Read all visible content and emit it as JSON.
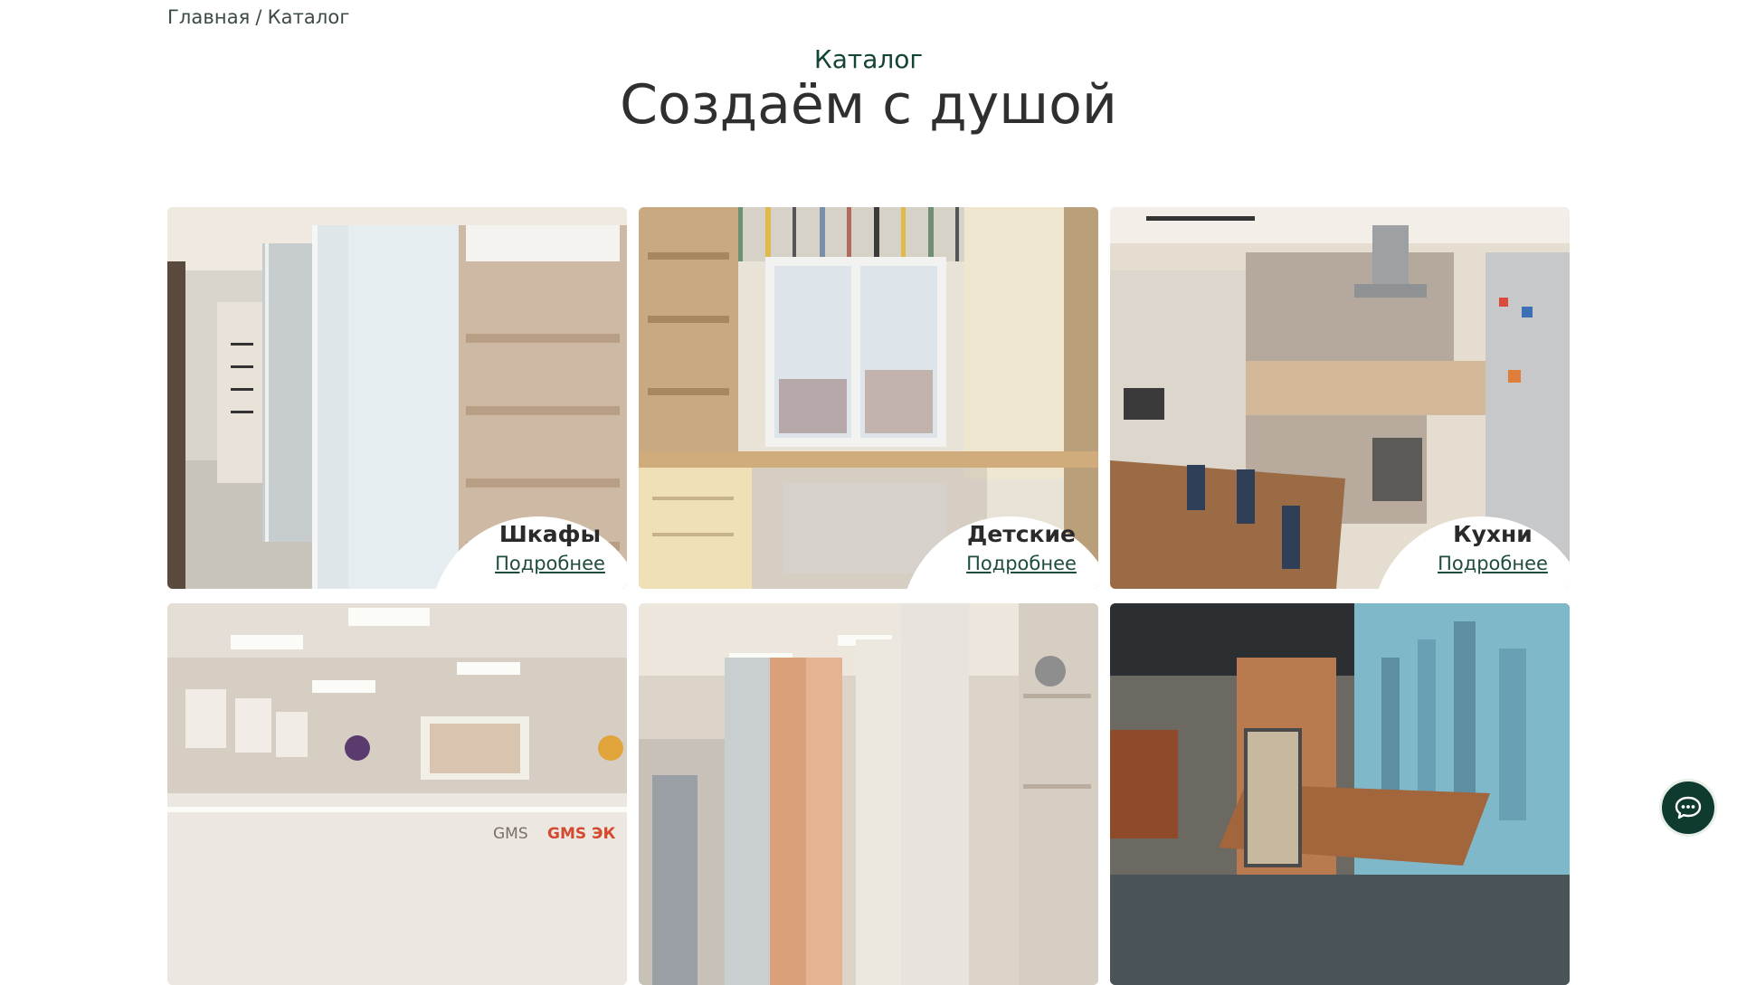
{
  "breadcrumb": {
    "home": "Главная",
    "separator": "/",
    "current": "Каталог"
  },
  "header": {
    "section_label": "Каталог",
    "title": "Создаём с душой"
  },
  "catalog": {
    "items": [
      {
        "title": "Шкафы",
        "link": "Подробнее",
        "image": "wardrobe-photo"
      },
      {
        "title": "Детские",
        "link": "Подробнее",
        "image": "kids-room-photo"
      },
      {
        "title": "Кухни",
        "link": "Подробнее",
        "image": "kitchen-photo"
      },
      {
        "title": "",
        "link": "",
        "image": "clinic-reception-photo"
      },
      {
        "title": "",
        "link": "",
        "image": "hallway-wardrobe-photo"
      },
      {
        "title": "",
        "link": "",
        "image": "office-photo"
      }
    ]
  },
  "photo_texts": {
    "clinic_logo": "GMS",
    "clinic_logo_2": "GMS ЭК"
  },
  "colors": {
    "accent": "#1e4d40",
    "dark_green": "#0f3a2f",
    "text": "#2f2f2f"
  },
  "chat": {
    "icon": "chat-bubble-icon"
  }
}
